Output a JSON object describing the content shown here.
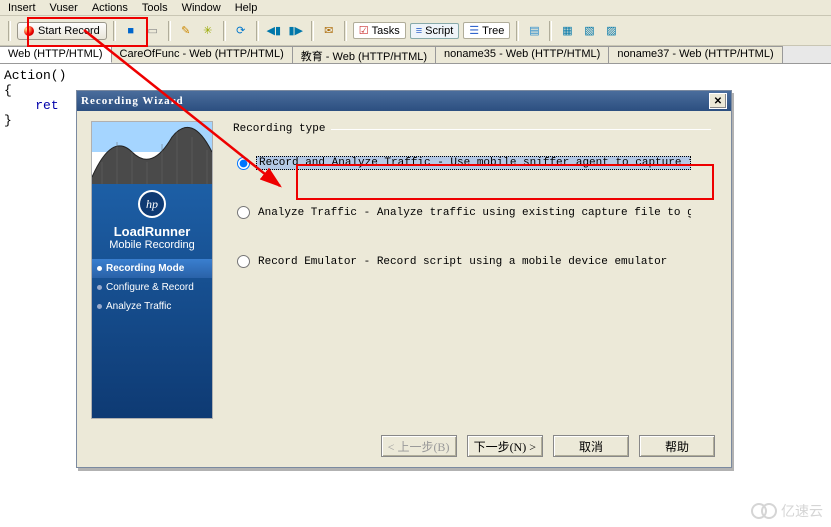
{
  "menu": {
    "items": [
      "Insert",
      "Vuser",
      "Actions",
      "Tools",
      "Window",
      "Help"
    ]
  },
  "toolbar": {
    "start_record_label": "Start Record",
    "tasks_label": "Tasks",
    "script_label": "Script",
    "tree_label": "Tree"
  },
  "tabs": [
    {
      "label": "Web (HTTP/HTML)",
      "active": true
    },
    {
      "label": "CareOfFunc - Web (HTTP/HTML)",
      "active": false
    },
    {
      "label": "教育 - Web (HTTP/HTML)",
      "active": false
    },
    {
      "label": "noname35 - Web (HTTP/HTML)",
      "active": false
    },
    {
      "label": "noname37 - Web (HTTP/HTML)",
      "active": false
    }
  ],
  "code": {
    "line1": "Action()",
    "line2": "{",
    "line3_kw": "ret",
    "line4": "}"
  },
  "dialog": {
    "title": "Recording Wizard",
    "brand_title": "LoadRunner",
    "brand_sub": "Mobile Recording",
    "brand_logo": "hp",
    "steps": [
      {
        "label": "Recording Mode",
        "active": true
      },
      {
        "label": "Configure & Record",
        "active": false
      },
      {
        "label": "Analyze Traffic",
        "active": false
      }
    ],
    "section_label": "Recording type",
    "options": [
      {
        "label": "Record and Analyze Traffic - Use mobile sniffer agent to capture traffic a",
        "selected": true
      },
      {
        "label": "Analyze Traffic - Analyze traffic using existing capture file to generate",
        "selected": false
      },
      {
        "label": "Record Emulator -  Record script using a mobile device emulator",
        "selected": false
      }
    ],
    "buttons": {
      "back": "< 上一步(B)",
      "next": "下一步(N) >",
      "cancel": "取消",
      "help": "帮助"
    }
  },
  "watermark": "亿速云"
}
